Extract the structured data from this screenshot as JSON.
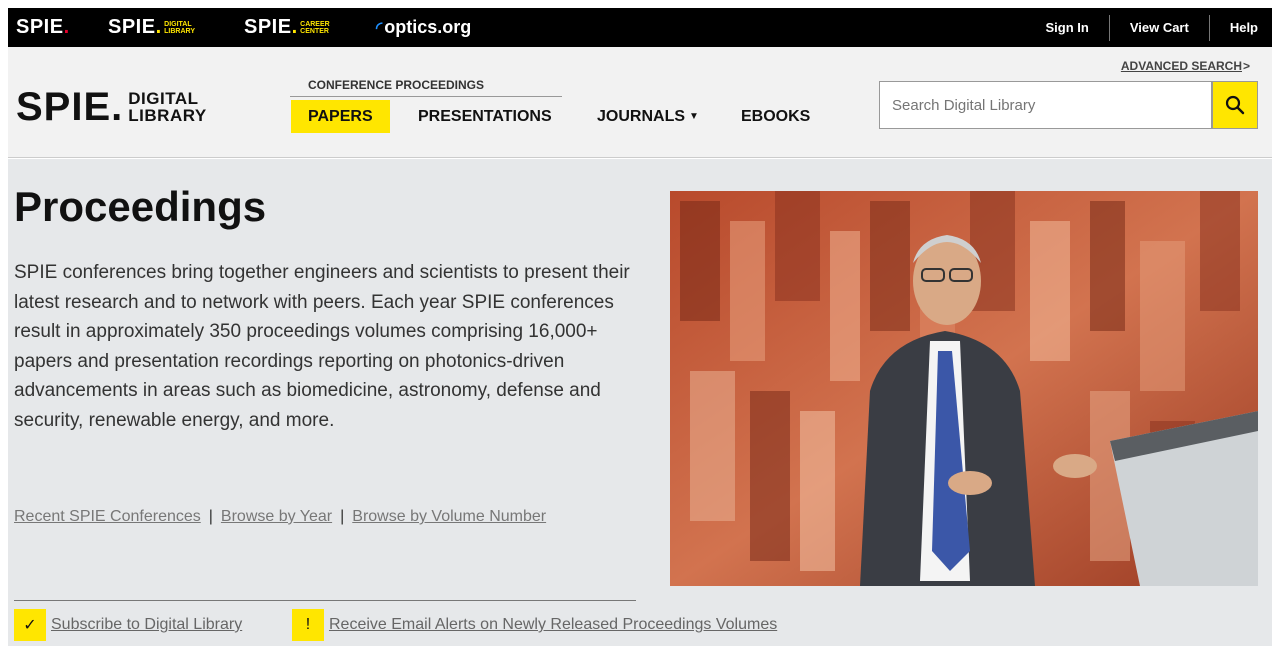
{
  "topbar": {
    "brands": {
      "spie": "SPIE",
      "dl_main": "SPIE",
      "dl_sub1": "DIGITAL",
      "dl_sub2": "LIBRARY",
      "cc_main": "SPIE",
      "cc_sub1": "CAREER",
      "cc_sub2": "CENTER",
      "optics": "optics.org"
    },
    "links": [
      "Sign In",
      "View Cart",
      "Help"
    ]
  },
  "header": {
    "logo_main": "SPIE",
    "logo_line1": "DIGITAL",
    "logo_line2": "LIBRARY",
    "conference_label": "CONFERENCE PROCEEDINGS",
    "nav": {
      "papers": "PAPERS",
      "presentations": "PRESENTATIONS",
      "journals": "JOURNALS",
      "ebooks": "EBOOKS"
    },
    "advanced_search": "ADVANCED SEARCH",
    "search_placeholder": "Search Digital Library"
  },
  "main": {
    "title": "Proceedings",
    "description": "SPIE conferences bring together engineers and scientists to present their latest research and to network with peers. Each year SPIE conferences result in approximately 350 proceedings volumes comprising 16,000+ papers and presentation recordings reporting on photonics-driven advancements in areas such as biomedicine, astronomy, defense and security, renewable energy, and more.",
    "links": [
      "Recent SPIE Conferences",
      "Browse by Year",
      "Browse by Volume Number"
    ],
    "subscribe_label": "Subscribe to Digital Library",
    "email_alert_label": "Receive Email Alerts on Newly Released Proceedings Volumes"
  },
  "colors": {
    "accent": "#ffe600",
    "topbar": "#000000",
    "header_bg": "#f2f2f2",
    "main_bg": "#e6e8ea"
  }
}
